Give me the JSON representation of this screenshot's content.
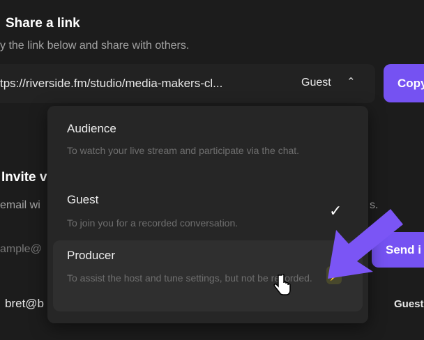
{
  "share": {
    "title": "Share a link",
    "subtitle": "y the link below and share with others.",
    "url": "tps://riverside.fm/studio/media-makers-cl...",
    "role": "Guest",
    "copy_label": "Copy"
  },
  "invite": {
    "title": "Invite v",
    "subtitle": "email wi",
    "subtitle_end": "s.",
    "email_placeholder": "ample@",
    "send_label": "Send i",
    "invitee_email": "bret@b",
    "invitee_role": "Guest"
  },
  "dropdown": {
    "options": [
      {
        "label": "Audience",
        "description": "To watch your live stream and participate via the chat.",
        "selected": false
      },
      {
        "label": "Guest",
        "description": "To join you for a recorded conversation.",
        "selected": true
      },
      {
        "label": "Producer",
        "description": "To assist the host and tune settings, but not be recorded.",
        "selected": false,
        "badge": "lightning-icon"
      }
    ]
  },
  "colors": {
    "accent": "#7552f2",
    "background": "#1c1c1c",
    "badge": "#c8e632"
  }
}
